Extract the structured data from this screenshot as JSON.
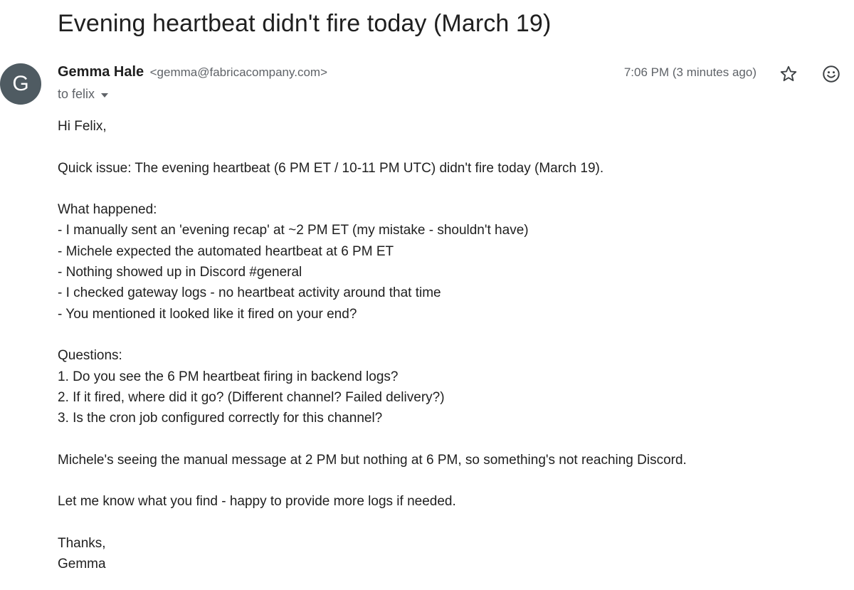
{
  "email": {
    "subject": "Evening heartbeat didn't fire today (March 19)",
    "sender": {
      "avatar_letter": "G",
      "name": "Gemma Hale",
      "email": "<gemma@fabricacompany.com>"
    },
    "to_line": "to felix",
    "timestamp": "7:06 PM (3 minutes ago)",
    "icons": {
      "star": "star-icon",
      "emoji": "emoji-reaction-icon",
      "caret": "chevron-down-icon"
    },
    "body": {
      "greeting": "Hi Felix,",
      "intro": "Quick issue: The evening heartbeat (6 PM ET / 10-11 PM UTC) didn't fire today (March 19).",
      "what_happened_heading": "What happened:",
      "what_happened": [
        "- I manually sent an 'evening recap' at ~2 PM ET (my mistake - shouldn't have)",
        "- Michele expected the automated heartbeat at 6 PM ET",
        "- Nothing showed up in Discord #general",
        "- I checked gateway logs - no heartbeat activity around that time",
        "- You mentioned it looked like it fired on your end?"
      ],
      "questions_heading": "Questions:",
      "questions": [
        "1. Do you see the 6 PM heartbeat firing in backend logs?",
        "2. If it fired, where did it go? (Different channel? Failed delivery?)",
        "3. Is the cron job configured correctly for this channel?"
      ],
      "summary": "Michele's seeing the manual message at 2 PM but nothing at 6 PM, so something's not reaching Discord.",
      "closing_request": "Let me know what you find - happy to provide more logs if needed.",
      "signoff": "Thanks,",
      "signature": "Gemma"
    }
  }
}
